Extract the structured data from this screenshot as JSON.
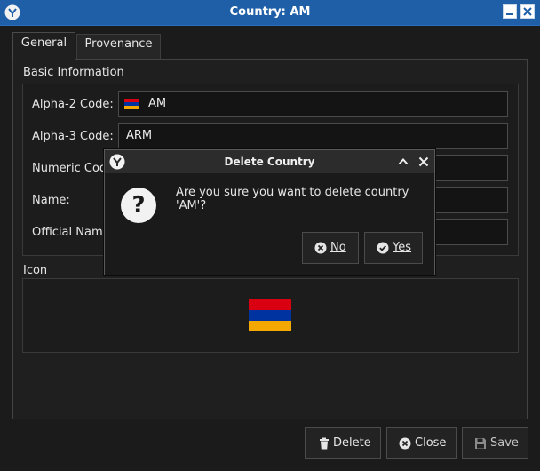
{
  "window": {
    "title": "Country: AM"
  },
  "tabs": [
    {
      "label": "General",
      "active": true
    },
    {
      "label": "Provenance",
      "active": false
    }
  ],
  "basic_info": {
    "title": "Basic Information",
    "fields": [
      {
        "label": "Alpha-2 Code:",
        "value": "AM",
        "has_flag": true
      },
      {
        "label": "Alpha-3 Code:",
        "value": "ARM"
      },
      {
        "label": "Numeric Code:",
        "value": ""
      },
      {
        "label": "Name:",
        "value": ""
      },
      {
        "label": "Official Name:",
        "value": ""
      }
    ]
  },
  "icon_section": {
    "title": "Icon"
  },
  "flag_colors": {
    "red": "#d90012",
    "blue": "#0033a0",
    "orange": "#f2a800"
  },
  "buttons": {
    "delete": "Delete",
    "close": "Close",
    "save": "Save"
  },
  "dialog": {
    "title": "Delete Country",
    "message": "Are you sure you want to delete country 'AM'?",
    "question_glyph": "?",
    "no_label": "No",
    "yes_label": "Yes"
  }
}
